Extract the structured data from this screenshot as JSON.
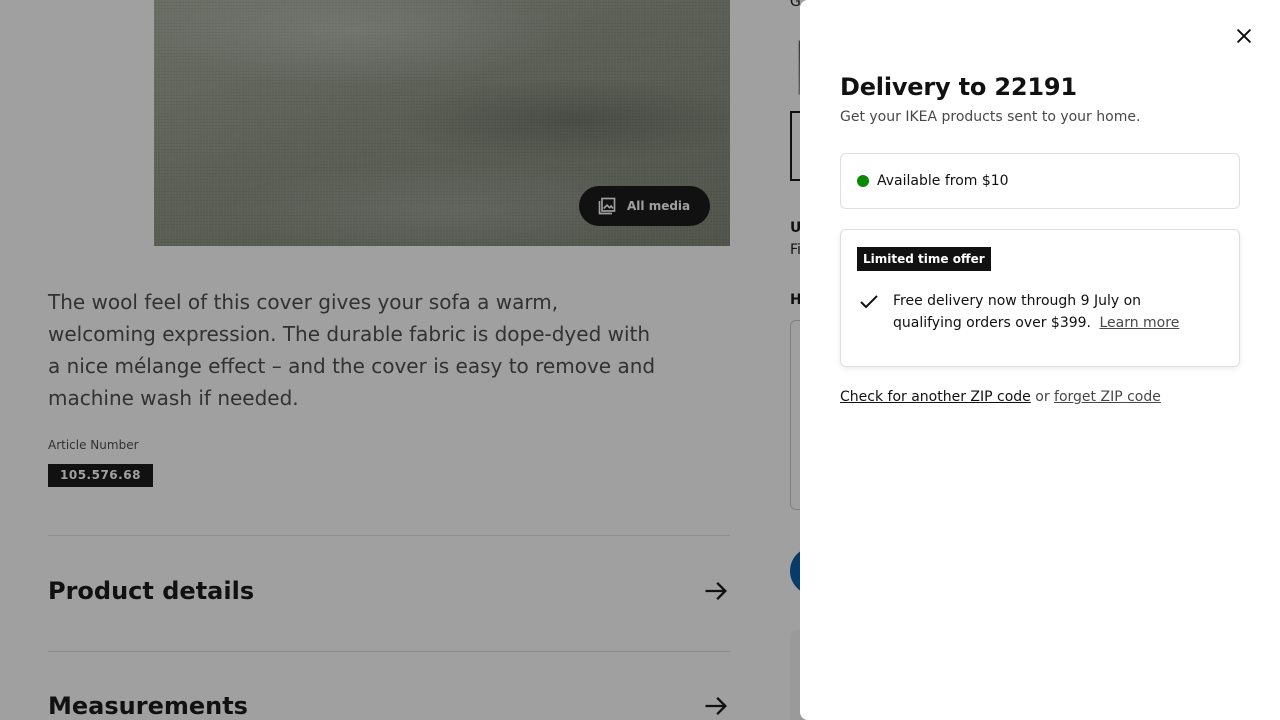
{
  "background": {
    "all_media_label": "All media",
    "description": "The wool feel of this cover gives your sofa a warm, welcoming expression. The durable fabric is dope-dyed with a nice mélange effect – and the cover is easy to remove and machine wash if needed.",
    "article_label": "Article Number",
    "article_number": "105.576.68",
    "sections": [
      {
        "label": "Product details"
      },
      {
        "label": "Measurements"
      }
    ],
    "right_col_fragments": [
      "G",
      "U",
      "Fi",
      "H"
    ]
  },
  "panel": {
    "title": "Delivery to 22191",
    "subtitle": "Get your IKEA products sent to your home.",
    "availability": {
      "text": "Available from $10",
      "status_color": "#0a8a00"
    },
    "offer": {
      "badge": "Limited time offer",
      "text": "Free delivery now through 9 July on qualifying orders over $399.",
      "link": "Learn more"
    },
    "zip": {
      "check_link": "Check for another ZIP code",
      "or_text": "or",
      "forget_link": "forget ZIP code"
    }
  }
}
